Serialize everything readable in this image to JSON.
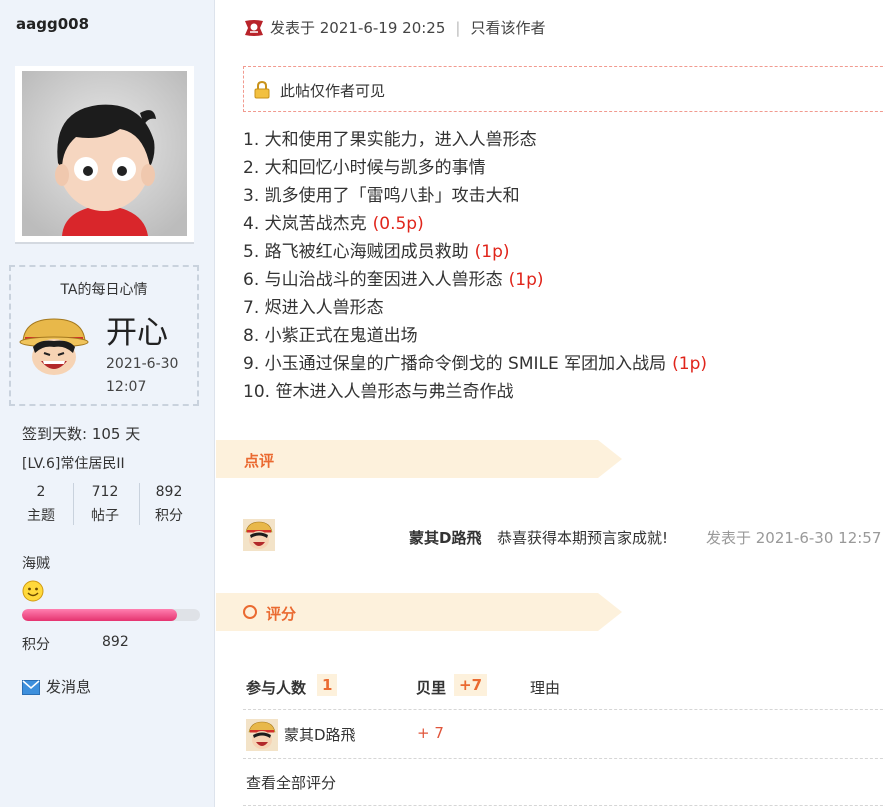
{
  "sidebar": {
    "username": "aagg008",
    "mood": {
      "title": "TA的每日心情",
      "value": "开心",
      "date": "2021-6-30",
      "time": "12:07",
      "icon": "happy-face-icon"
    },
    "checkin": "签到天数: 105 天",
    "level": "[LV.6]常住居民II",
    "stats": [
      {
        "value": "2",
        "label": "主题"
      },
      {
        "value": "712",
        "label": "帖子"
      },
      {
        "value": "892",
        "label": "积分"
      }
    ],
    "group": "海贼",
    "points_label": "积分",
    "points_value": "892",
    "points_progress": 0.87,
    "send_message": "发消息"
  },
  "post": {
    "posted_at": "发表于 2021-6-19 20:25",
    "separator": "|",
    "author_only": "只看该作者",
    "locked_notice": "此帖仅作者可见",
    "items": [
      {
        "text": "1. 大和使用了果实能力，进入人兽形态",
        "points": ""
      },
      {
        "text": "2. 大和回忆小时候与凯多的事情",
        "points": ""
      },
      {
        "text": "3. 凯多使用了「雷鸣八卦」攻击大和",
        "points": ""
      },
      {
        "text": "4. 犬岚苦战杰克",
        "points": "(0.5p)"
      },
      {
        "text": "5. 路飞被红心海贼团成员救助",
        "points": "(1p)"
      },
      {
        "text": "6. 与山治战斗的奎因进入人兽形态",
        "points": "(1p)"
      },
      {
        "text": "7. 烬进入人兽形态",
        "points": ""
      },
      {
        "text": "8. 小紫正式在鬼道出场",
        "points": ""
      },
      {
        "text": "9. 小玉通过保皇的广播命令倒戈的 SMILE 军团加入战局",
        "points": "(1p)"
      },
      {
        "text": "10. 笹木进入人兽形态与弗兰奇作战",
        "points": ""
      }
    ]
  },
  "comments": {
    "title": "点评",
    "author": "蒙其D路飛",
    "text": "恭喜获得本期预言家成就!",
    "time": "发表于 2021-6-30 12:57"
  },
  "rating": {
    "title": "评分",
    "participants_label": "参与人数",
    "participants_count": "1",
    "beili_label": "贝里",
    "beili_total": "+7",
    "reason_label": "理由",
    "rows": [
      {
        "user": "蒙其D路飛",
        "score": "+ 7",
        "reason": ""
      }
    ],
    "view_all": "查看全部评分"
  },
  "colors": {
    "sidebar_bg": "#eef3fa",
    "accent_orange": "#ea6a31",
    "points_red": "#e0251b",
    "section_band": "#fdf1dc"
  }
}
